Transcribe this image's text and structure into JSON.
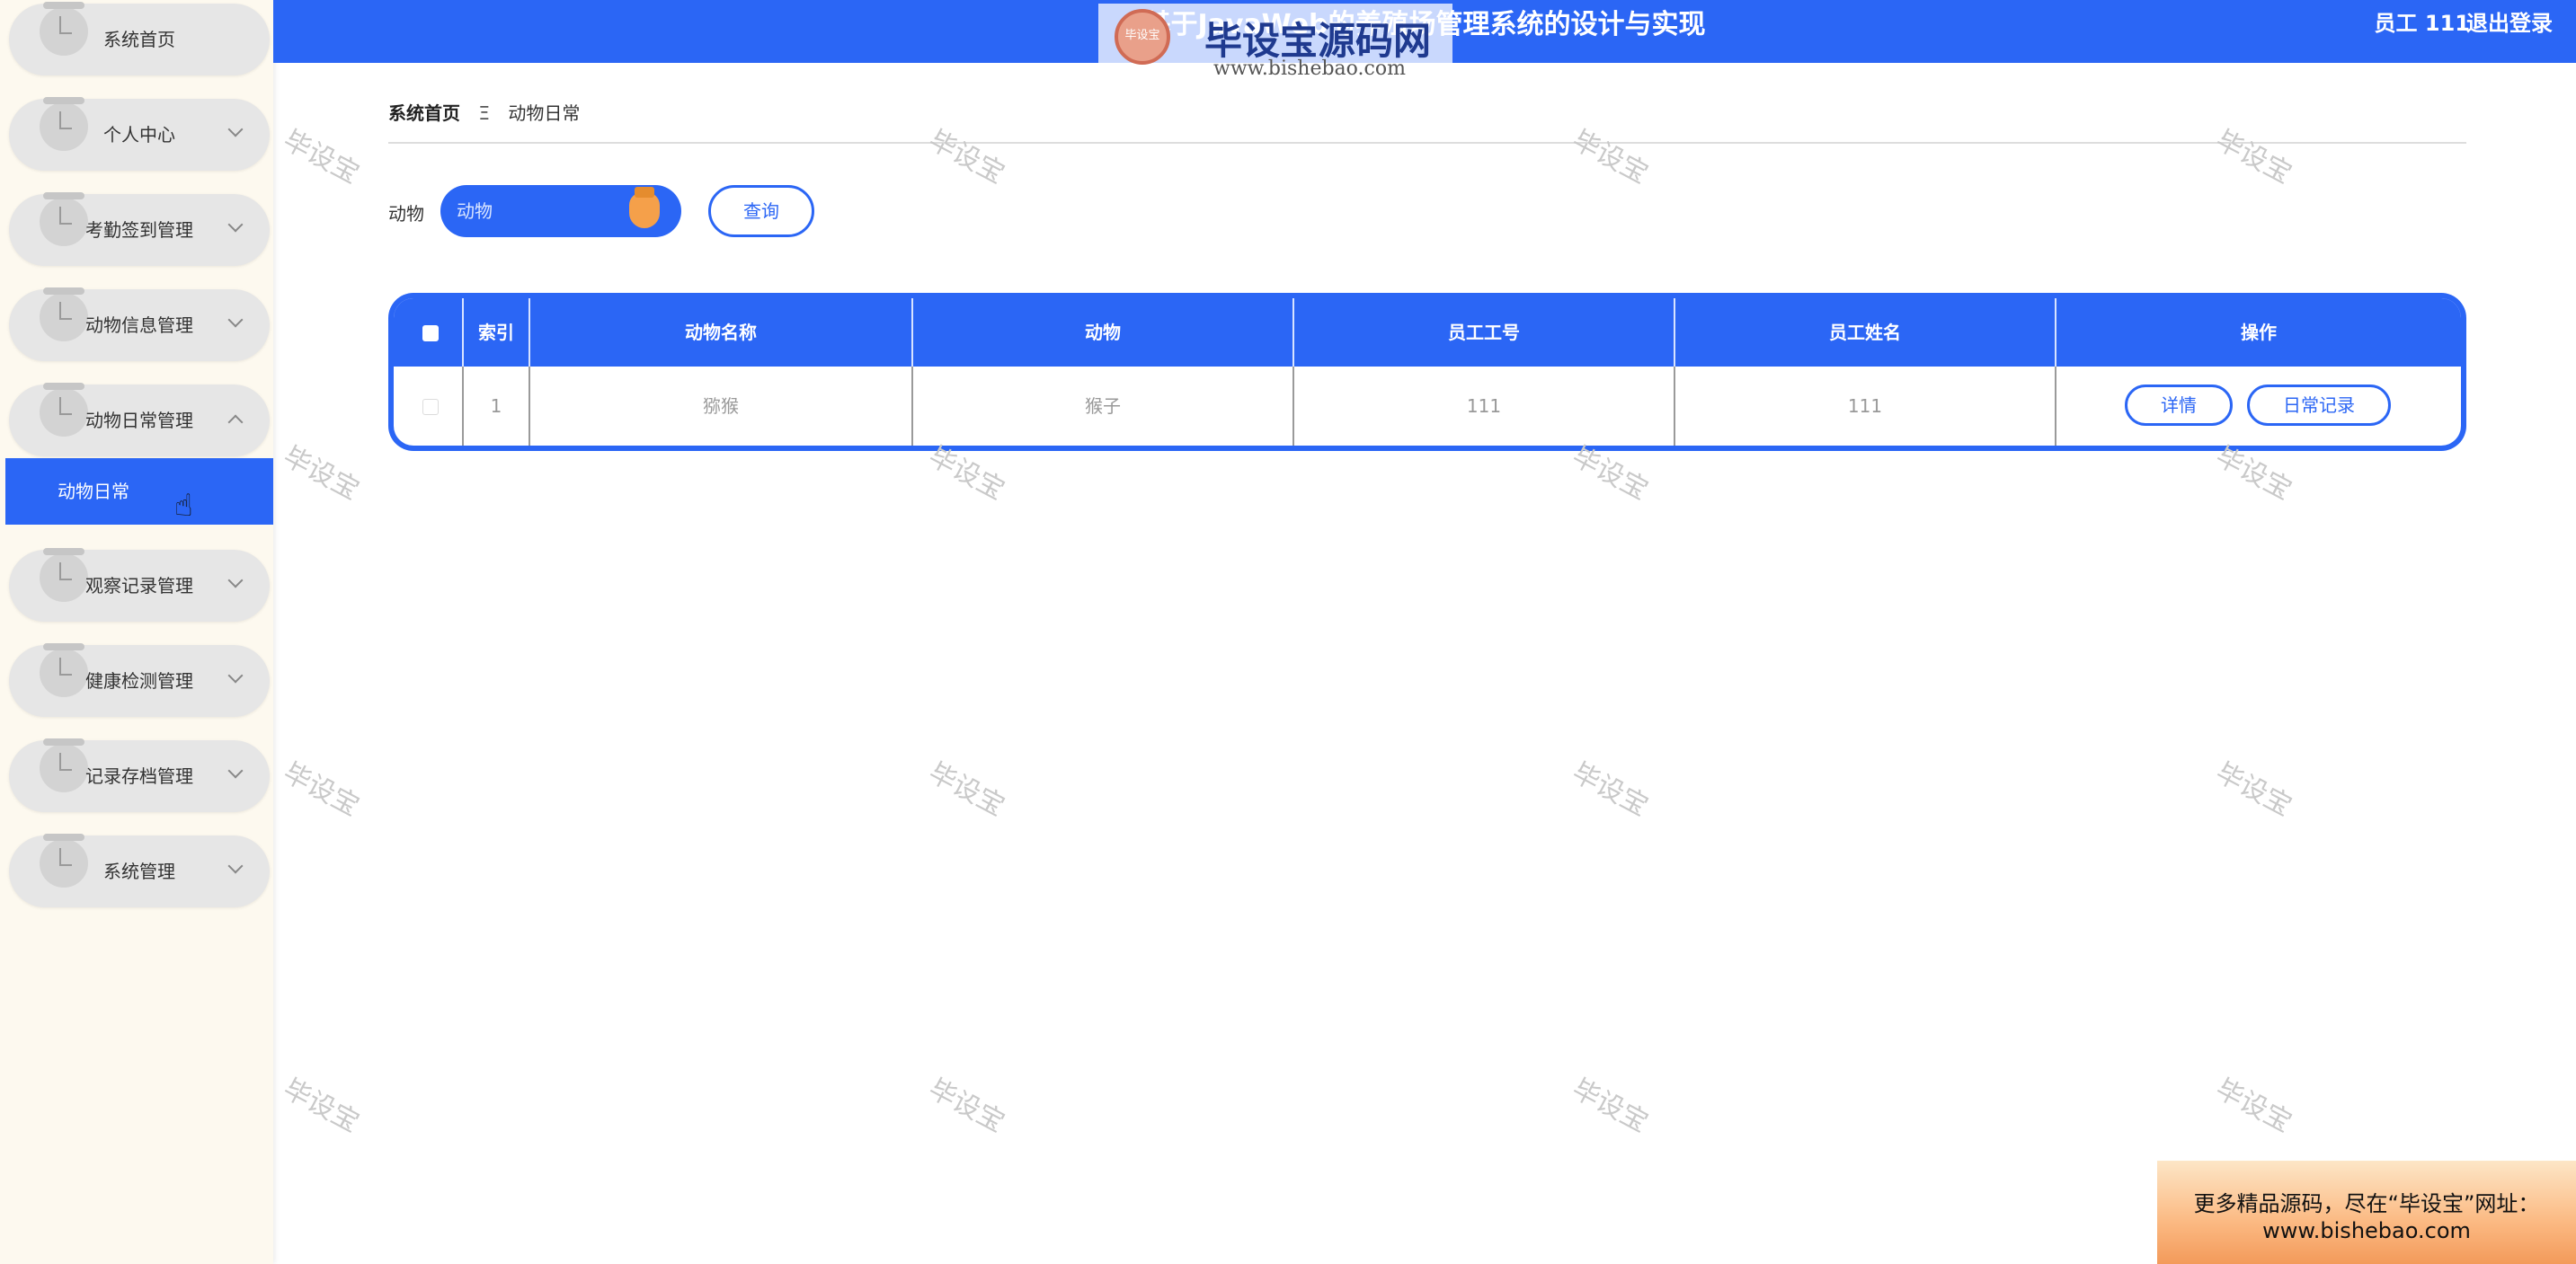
{
  "header": {
    "title": "基于JavaWeb的养殖场管理系统的设计与实现",
    "user_label": "员工 111",
    "logout_label": "退出登录"
  },
  "site_logo": {
    "badge_text": "毕设宝",
    "main_text": "毕设宝源码网",
    "url_text": "www.bishebao.com"
  },
  "sidebar": {
    "items": [
      {
        "label": "系统首页",
        "expandable": false
      },
      {
        "label": "个人中心",
        "expandable": true
      },
      {
        "label": "考勤签到管理",
        "expandable": true
      },
      {
        "label": "动物信息管理",
        "expandable": true
      },
      {
        "label": "动物日常管理",
        "expandable": true,
        "expanded": true
      },
      {
        "label": "观察记录管理",
        "expandable": true
      },
      {
        "label": "健康检测管理",
        "expandable": true
      },
      {
        "label": "记录存档管理",
        "expandable": true
      },
      {
        "label": "系统管理",
        "expandable": true
      }
    ],
    "active_sub": "动物日常"
  },
  "breadcrumb": {
    "home": "系统首页",
    "separator": "Ξ",
    "current": "动物日常"
  },
  "search": {
    "label": "动物",
    "placeholder": "动物",
    "button_label": "查询"
  },
  "table": {
    "columns": [
      "索引",
      "动物名称",
      "动物",
      "员工工号",
      "员工姓名",
      "操作"
    ],
    "rows": [
      {
        "index": "1",
        "name": "猕猴",
        "animal": "猴子",
        "emp_no": "111",
        "emp_name": "111"
      }
    ],
    "actions": [
      "详情",
      "日常记录"
    ]
  },
  "watermark_text": "毕设宝",
  "promo": {
    "line1": "更多精品源码，尽在“毕设宝”网址：",
    "line2": "www.bishebao.com"
  },
  "colors": {
    "primary": "#2b66f5",
    "sidebar_bg": "#fdf9ef",
    "menu_pill": "#e6e6e6",
    "accent_orange": "#f5a04a"
  }
}
